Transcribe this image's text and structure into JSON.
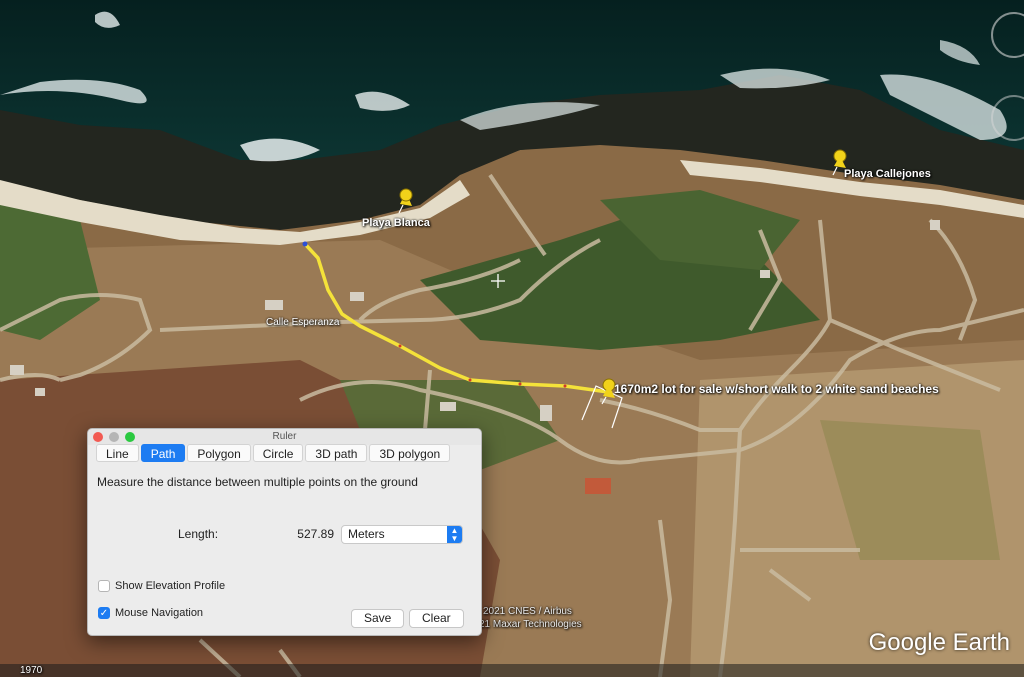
{
  "map": {
    "pins": [
      {
        "name": "playa-blanca",
        "label": "Playa Blanca"
      },
      {
        "name": "playa-callejones",
        "label": "Playa Callejones"
      }
    ],
    "road_label": "Calle Esperanza",
    "lot_label": "1670m2 lot for sale w/short walk to 2 white sand beaches",
    "attribution_line1": "2021 CNES / Airbus",
    "attribution_line2": "21 Maxar Technologies",
    "year": "1970",
    "brand": "Google Earth",
    "colors": {
      "path": "#f4e23a",
      "pin": "#f1d21a",
      "ocean": "#0d2f2f"
    }
  },
  "ruler": {
    "title": "Ruler",
    "tabs": [
      "Line",
      "Path",
      "Polygon",
      "Circle",
      "3D path",
      "3D polygon"
    ],
    "active_tab": "Path",
    "description": "Measure the distance between multiple points on the ground",
    "length_label": "Length:",
    "length_value": "527.89",
    "unit": "Meters",
    "show_elevation_label": "Show Elevation Profile",
    "show_elevation_checked": false,
    "mouse_navigation_label": "Mouse Navigation",
    "mouse_navigation_checked": true,
    "save_label": "Save",
    "clear_label": "Clear"
  }
}
